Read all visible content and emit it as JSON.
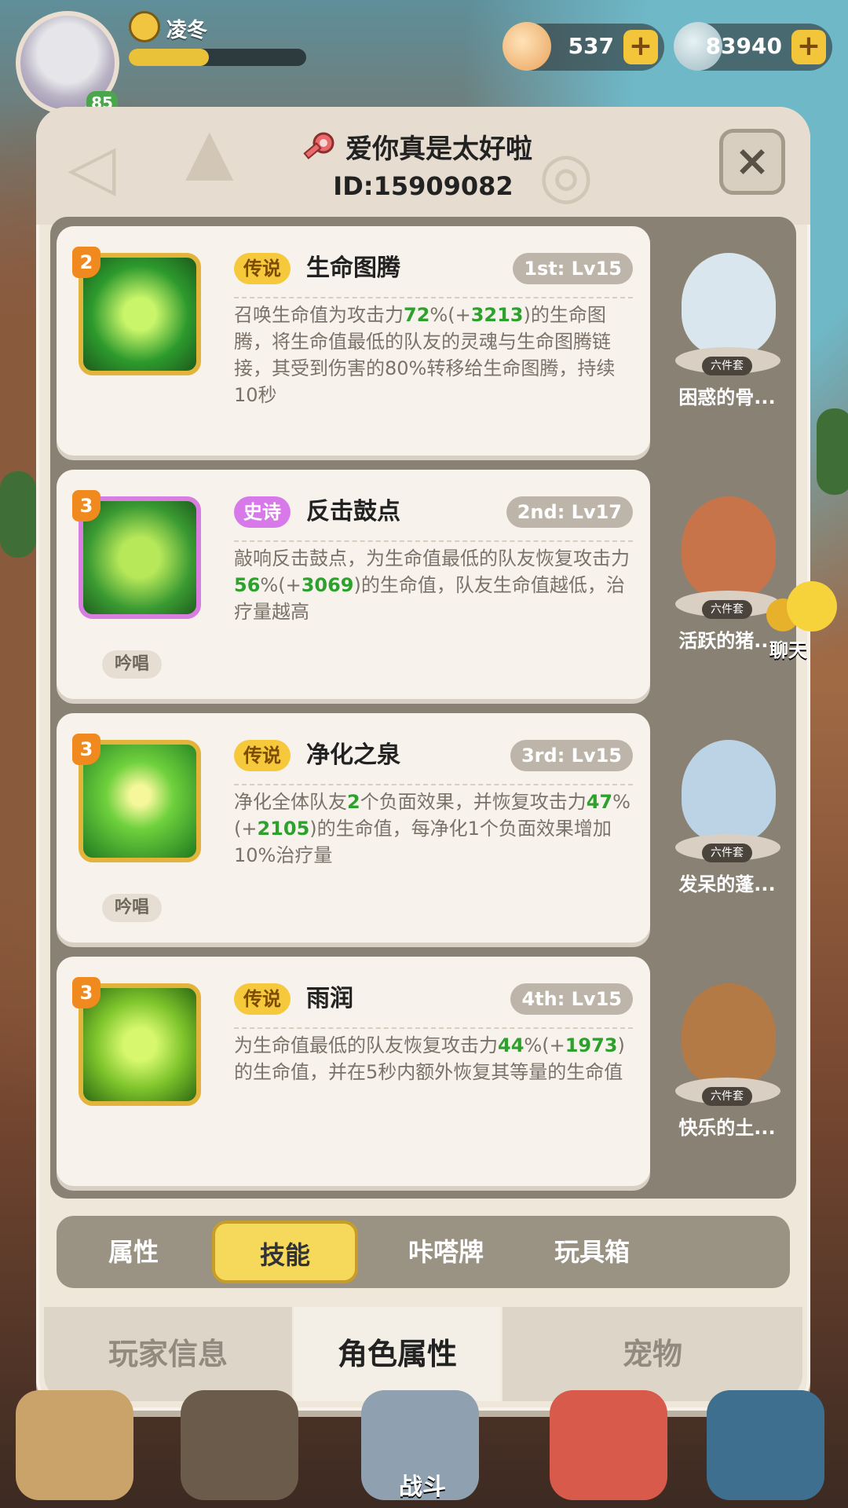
{
  "player": {
    "name": "凌冬",
    "level": "85",
    "xp_fraction": 0.45
  },
  "currencies": [
    {
      "value": "537",
      "icon": "shell-star-icon",
      "plus": "+"
    },
    {
      "value": "83940",
      "icon": "clam-icon",
      "plus": "+"
    }
  ],
  "modal": {
    "title": "爱你真是太好啦",
    "id_text": "ID:15909082",
    "close_label": "×"
  },
  "skills": [
    {
      "badge": "2",
      "rarity": "传说",
      "rarity_type": "legend",
      "name": "生命图腾",
      "rank": "1st: Lv15",
      "desc_parts": [
        "召唤生命值为攻击力",
        "72",
        "%(+",
        "3213",
        ")的生命图腾，将生命值最低的队友的灵魂与生命图腾链接，其受到伤害的80%转移给生命图腾，持续10秒"
      ],
      "chant": "",
      "pet_name": "困惑的骨...",
      "pet_tag": "六件套"
    },
    {
      "badge": "3",
      "rarity": "史诗",
      "rarity_type": "epic",
      "name": "反击鼓点",
      "rank": "2nd: Lv17",
      "desc_parts": [
        "敲响反击鼓点，为生命值最低的队友恢复攻击力",
        "56",
        "%(+",
        "3069",
        ")的生命值，队友生命值越低，治疗量越高"
      ],
      "chant": "吟唱",
      "pet_name": "活跃的猪...",
      "pet_tag": "六件套"
    },
    {
      "badge": "3",
      "rarity": "传说",
      "rarity_type": "legend",
      "name": "净化之泉",
      "rank": "3rd: Lv15",
      "desc_parts": [
        "净化全体队友",
        "2",
        "个负面效果，并恢复攻击力",
        "47",
        "%(+",
        "2105",
        ")的生命值，每净化1个负面效果增加10%治疗量"
      ],
      "chant": "吟唱",
      "pet_name": "发呆的蓬...",
      "pet_tag": "六件套"
    },
    {
      "badge": "3",
      "rarity": "传说",
      "rarity_type": "legend",
      "name": "雨润",
      "rank": "4th: Lv15",
      "desc_parts": [
        "为生命值最低的队友恢复攻击力",
        "44",
        "%(+",
        "1973",
        ")的生命值，并在5秒内额外恢复其等量的生命值"
      ],
      "chant": "",
      "pet_name": "快乐的土...",
      "pet_tag": "六件套"
    }
  ],
  "tabs": [
    "属性",
    "技能",
    "咔嗒牌",
    "玩具箱"
  ],
  "active_tab": 1,
  "bottom_tabs": [
    "玩家信息",
    "角色属性",
    "宠物"
  ],
  "active_bottom_tab": 1,
  "chat_label": "聊天",
  "nav": {
    "battle_label": "战斗"
  },
  "colors": {
    "legend": "#f6c93d",
    "epic": "#d879ea",
    "highlight_green": "#2ea02e",
    "active_tab": "#f6d85a"
  }
}
